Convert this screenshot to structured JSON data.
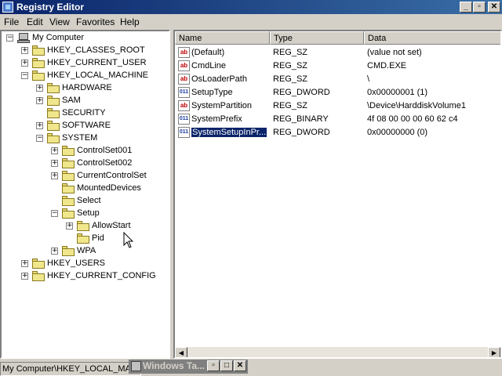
{
  "window": {
    "title": "Registry Editor"
  },
  "menu": [
    "File",
    "Edit",
    "View",
    "Favorites",
    "Help"
  ],
  "tree": [
    {
      "label": "My Computer",
      "icon": "computer-icon",
      "expander": "−"
    },
    {
      "label": "HKEY_CLASSES_ROOT",
      "icon": "folder-icon",
      "expander": "+"
    },
    {
      "label": "HKEY_CURRENT_USER",
      "icon": "folder-icon",
      "expander": "+"
    },
    {
      "label": "HKEY_LOCAL_MACHINE",
      "icon": "folder-open-icon",
      "expander": "−"
    },
    {
      "label": "HARDWARE",
      "icon": "folder-icon",
      "expander": "+"
    },
    {
      "label": "SAM",
      "icon": "folder-icon",
      "expander": "+"
    },
    {
      "label": "SECURITY",
      "icon": "folder-icon",
      "expander": ""
    },
    {
      "label": "SOFTWARE",
      "icon": "folder-icon",
      "expander": "+"
    },
    {
      "label": "SYSTEM",
      "icon": "folder-open-icon",
      "expander": "−"
    },
    {
      "label": "ControlSet001",
      "icon": "folder-icon",
      "expander": "+"
    },
    {
      "label": "ControlSet002",
      "icon": "folder-icon",
      "expander": "+"
    },
    {
      "label": "CurrentControlSet",
      "icon": "folder-icon",
      "expander": "+"
    },
    {
      "label": "MountedDevices",
      "icon": "folder-icon",
      "expander": ""
    },
    {
      "label": "Select",
      "icon": "folder-icon",
      "expander": ""
    },
    {
      "label": "Setup",
      "icon": "folder-open-icon",
      "expander": "−"
    },
    {
      "label": "AllowStart",
      "icon": "folder-icon",
      "expander": "+"
    },
    {
      "label": "Pid",
      "icon": "folder-icon",
      "expander": ""
    },
    {
      "label": "WPA",
      "icon": "folder-icon",
      "expander": "+"
    },
    {
      "label": "HKEY_USERS",
      "icon": "folder-icon",
      "expander": "+"
    },
    {
      "label": "HKEY_CURRENT_CONFIG",
      "icon": "folder-icon",
      "expander": "+"
    }
  ],
  "columns": [
    "Name",
    "Type",
    "Data"
  ],
  "values": [
    {
      "name": "(Default)",
      "type": "REG_SZ",
      "data": "(value not set)",
      "icon": "ab"
    },
    {
      "name": "CmdLine",
      "type": "REG_SZ",
      "data": "CMD.EXE",
      "icon": "ab"
    },
    {
      "name": "OsLoaderPath",
      "type": "REG_SZ",
      "data": "\\",
      "icon": "ab"
    },
    {
      "name": "SetupType",
      "type": "REG_DWORD",
      "data": "0x00000001 (1)",
      "icon": "bin"
    },
    {
      "name": "SystemPartition",
      "type": "REG_SZ",
      "data": "\\Device\\HarddiskVolume1",
      "icon": "ab"
    },
    {
      "name": "SystemPrefix",
      "type": "REG_BINARY",
      "data": "4f 08 00 00 00 60 62 c4",
      "icon": "bin"
    },
    {
      "name": "SystemSetupInPr...",
      "type": "REG_DWORD",
      "data": "0x00000000 (0)",
      "icon": "bin",
      "selected": true
    }
  ],
  "statusbar": {
    "path": "My Computer\\HKEY_LOCAL_MAC"
  },
  "minimized_window": {
    "title": "Windows Ta..."
  },
  "icon_glyphs": {
    "ab": "ab",
    "bin": "011"
  }
}
